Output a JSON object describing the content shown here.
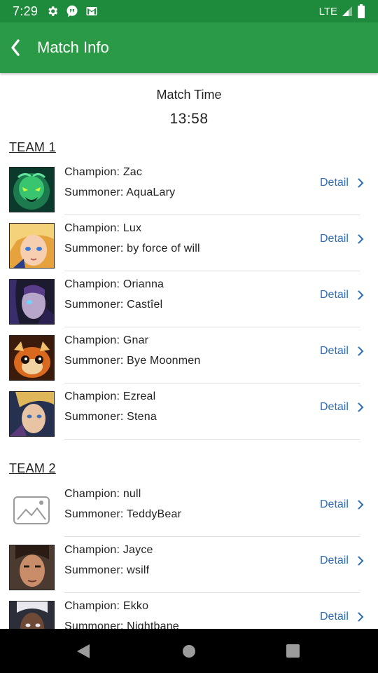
{
  "status_bar": {
    "time": "7:29",
    "network": "LTE",
    "icons": [
      "gear-icon",
      "chat-icon",
      "gmail-icon",
      "signal-icon",
      "battery-icon"
    ]
  },
  "app_bar": {
    "title": "Match Info",
    "back_icon": "back-arrow-icon",
    "color": "#2a9a47"
  },
  "match": {
    "time_label": "Match Time",
    "time_value": "13:58"
  },
  "teams": [
    {
      "name": "TEAM 1",
      "players": [
        {
          "champion": "Champion: Zac",
          "summoner": "Summoner: AquaLary",
          "detail": "Detail"
        },
        {
          "champion": "Champion: Lux",
          "summoner": "Summoner: by force of will",
          "detail": "Detail"
        },
        {
          "champion": "Champion: Orianna",
          "summoner": "Summoner: Castîel",
          "detail": "Detail"
        },
        {
          "champion": "Champion: Gnar",
          "summoner": "Summoner: Bye Moonmen",
          "detail": "Detail"
        },
        {
          "champion": "Champion: Ezreal",
          "summoner": "Summoner: Stena",
          "detail": "Detail"
        }
      ]
    },
    {
      "name": "TEAM 2",
      "players": [
        {
          "champion": "Champion: null",
          "summoner": "Summoner: TeddyBear",
          "detail": "Detail"
        },
        {
          "champion": "Champion: Jayce",
          "summoner": "Summoner: wsilf",
          "detail": "Detail"
        },
        {
          "champion": "Champion: Ekko",
          "summoner": "Summoner: Nightbane",
          "detail": "Detail"
        }
      ]
    }
  ],
  "colors": {
    "status_bar": "#1e8a3c",
    "link": "#2d6db5"
  }
}
